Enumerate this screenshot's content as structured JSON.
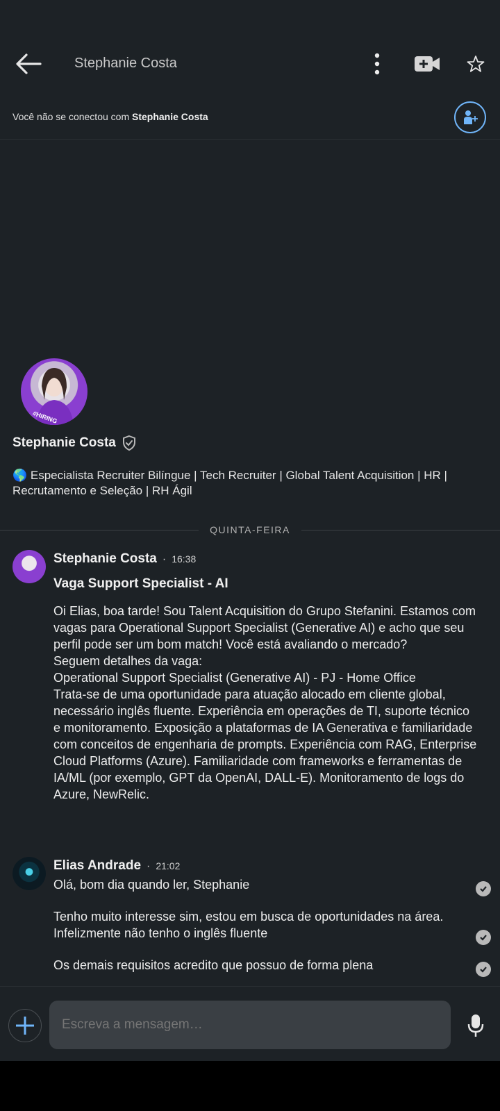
{
  "header": {
    "title": "Stephanie Costa",
    "back_icon": "arrow-left-icon",
    "menu_icon": "more-vertical-icon",
    "video_icon": "video-call-icon",
    "star_icon": "star-outline-icon"
  },
  "connection": {
    "prefix": "Você não se conectou com ",
    "name": "Stephanie Costa",
    "add_icon": "add-person-icon"
  },
  "profile": {
    "name": "Stephanie Costa",
    "verified_icon": "verified-shield-icon",
    "headline": "🌎 Especialista Recruiter Bilíngue | Tech Recruiter | Global Talent Acquisition | HR | Recrutamento e Seleção | RH Ágil",
    "avatar_badge": "#HIRING"
  },
  "day_separator": "QUINTA-FEIRA",
  "messages": [
    {
      "sender": "Stephanie Costa",
      "time": "16:38",
      "subject": "Vaga Support Specialist - AI",
      "body": "Oi Elias, boa tarde! Sou Talent Acquisition do Grupo Stefanini. Estamos com vagas para Operational Support Specialist (Generative AI) e acho que seu perfil pode ser um bom match! Você está avaliando o mercado?\nSeguem detalhes da vaga:\nOperational Support Specialist (Generative AI) - PJ - Home Office\nTrata-se de uma oportunidade para atuação alocado em cliente global, necessário inglês fluente. Experiência em operações de TI, suporte técnico e monitoramento. Exposição a plataformas de IA Generativa e familiaridade com conceitos de engenharia de prompts. Experiência com RAG, Enterprise Cloud Platforms (Azure). Familiaridade com frameworks e ferramentas de IA/ML (por exemplo, GPT da OpenAI, DALL-E). Monitoramento de logs do Azure, NewRelic."
    },
    {
      "sender": "Elias Andrade",
      "time": "21:02",
      "lines": [
        "Olá,  bom dia quando ler, Stephanie",
        "Tenho muito interesse sim, estou em busca de oportunidades na área. Infelizmente não tenho o inglês fluente",
        "Os demais requisitos acredito que possuo de forma plena"
      ]
    }
  ],
  "composer": {
    "placeholder": "Escreva a mensagem…",
    "plus_icon": "plus-icon",
    "mic_icon": "microphone-icon"
  },
  "colors": {
    "background": "#1d2226",
    "accent": "#70b5f9",
    "input_bg": "#3a3f44"
  }
}
